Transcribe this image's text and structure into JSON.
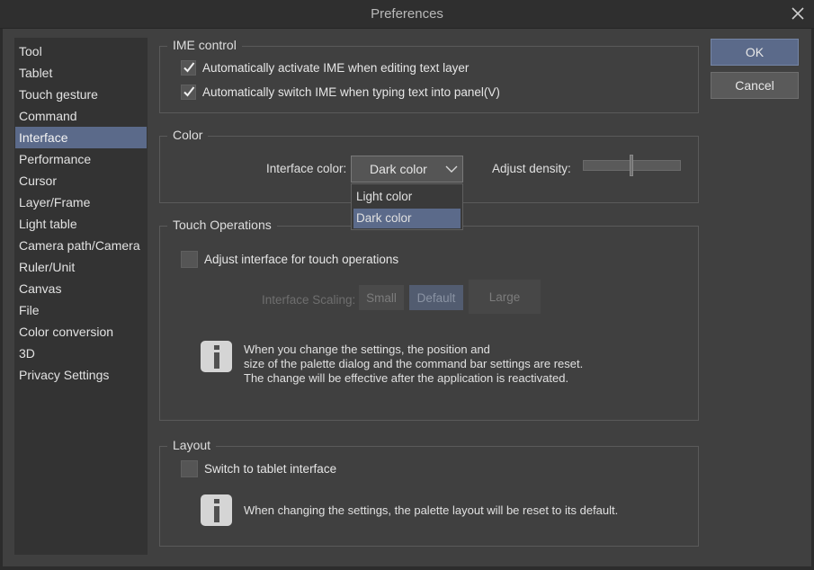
{
  "window": {
    "title": "Preferences"
  },
  "sidebar": {
    "items": [
      {
        "label": "Tool"
      },
      {
        "label": "Tablet"
      },
      {
        "label": "Touch gesture"
      },
      {
        "label": "Command"
      },
      {
        "label": "Interface"
      },
      {
        "label": "Performance"
      },
      {
        "label": "Cursor"
      },
      {
        "label": "Layer/Frame"
      },
      {
        "label": "Light table"
      },
      {
        "label": "Camera path/Camera"
      },
      {
        "label": "Ruler/Unit"
      },
      {
        "label": "Canvas"
      },
      {
        "label": "File"
      },
      {
        "label": "Color conversion"
      },
      {
        "label": "3D"
      },
      {
        "label": "Privacy Settings"
      }
    ],
    "selected": "Interface"
  },
  "buttons": {
    "ok": "OK",
    "cancel": "Cancel"
  },
  "ime": {
    "legend": "IME control",
    "auto_activate": {
      "label": "Automatically activate IME when editing text layer",
      "checked": true
    },
    "auto_switch": {
      "label": "Automatically switch IME when typing text into panel(V)",
      "checked": true
    }
  },
  "color": {
    "legend": "Color",
    "interface_color_label": "Interface color:",
    "interface_color_value": "Dark color",
    "options": [
      "Light color",
      "Dark color"
    ],
    "density_label": "Adjust density:",
    "density_level": 0.5
  },
  "touch": {
    "legend": "Touch Operations",
    "adjust": {
      "label": "Adjust interface for touch operations",
      "checked": false
    },
    "scaling_label": "Interface Scaling:",
    "scaling_options": [
      "Small",
      "Default",
      "Large"
    ],
    "scaling_selected": "Default",
    "info": [
      "When you change the settings, the position and",
      "size of the palette dialog and the command bar settings are reset.",
      "The change will be effective after the application is reactivated."
    ]
  },
  "layout": {
    "legend": "Layout",
    "tablet": {
      "label": "Switch to tablet interface",
      "checked": false
    },
    "info": "When changing the settings, the palette layout will be reset to its default."
  },
  "colors": {
    "background": "#404040",
    "sidebar": "#333333",
    "accent": "#5b6a8a"
  }
}
